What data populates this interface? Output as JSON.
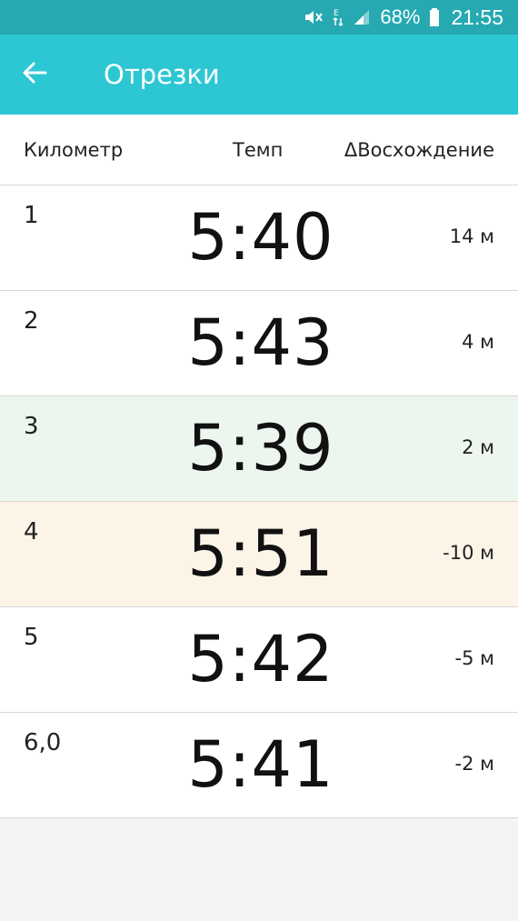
{
  "status_bar": {
    "battery": "68%",
    "time": "21:55"
  },
  "app_bar": {
    "title": "Отрезки",
    "back_icon": "arrow-back-icon"
  },
  "table": {
    "headers": {
      "km": "Километр",
      "pace": "Темп",
      "elevation": "ΔВосхождение"
    },
    "rows": [
      {
        "km": "1",
        "pace": "5:40",
        "elevation": "14 м"
      },
      {
        "km": "2",
        "pace": "5:43",
        "elevation": "4 м"
      },
      {
        "km": "3",
        "pace": "5:39",
        "elevation": "2 м"
      },
      {
        "km": "4",
        "pace": "5:51",
        "elevation": "-10 м"
      },
      {
        "km": "5",
        "pace": "5:42",
        "elevation": "-5 м"
      },
      {
        "km": "6,0",
        "pace": "5:41",
        "elevation": "-2 м"
      }
    ]
  },
  "colors": {
    "status_bar": "#26a9b1",
    "app_bar": "#2dc7d4",
    "fastest_row": "#edf6ee",
    "slowest_row": "#fdf4e8"
  }
}
